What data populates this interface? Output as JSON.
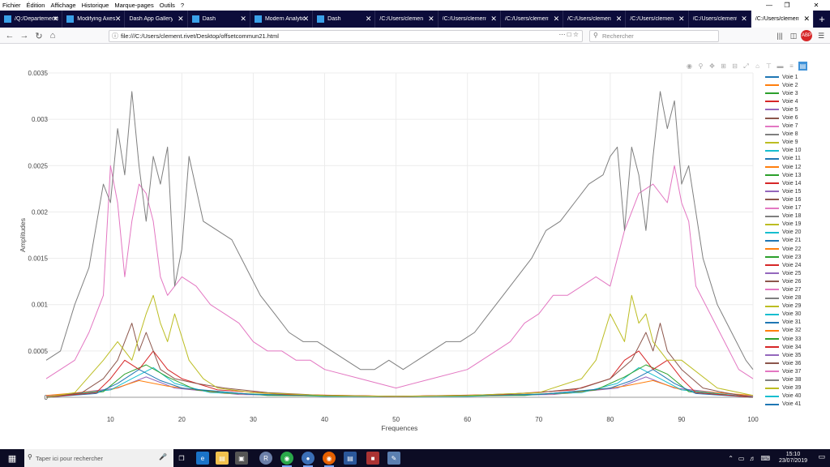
{
  "menubar": {
    "items": [
      "Fichier",
      "Édition",
      "Affichage",
      "Historique",
      "Marque-pages",
      "Outils",
      "?"
    ]
  },
  "tabs": [
    {
      "label": "/Q:/Departements/",
      "icon": "document-icon",
      "active": false
    },
    {
      "label": "Modifying Axes",
      "icon": "plotly-icon",
      "active": false
    },
    {
      "label": "Dash App Gallery",
      "icon": "none",
      "active": false
    },
    {
      "label": "Dash",
      "icon": "dash-icon",
      "active": false
    },
    {
      "label": "Modern Analytic",
      "icon": "plotly-icon",
      "active": false
    },
    {
      "label": "Dash",
      "icon": "dash-icon",
      "active": false
    },
    {
      "label": "/C:/Users/clement.",
      "icon": "none",
      "active": false
    },
    {
      "label": "/C:/Users/clement.",
      "icon": "none",
      "active": false
    },
    {
      "label": "/C:/Users/clement.",
      "icon": "none",
      "active": false
    },
    {
      "label": "/C:/Users/clement.",
      "icon": "none",
      "active": false
    },
    {
      "label": "/C:/Users/clement.",
      "icon": "none",
      "active": false
    },
    {
      "label": "/C:/Users/clement.",
      "icon": "none",
      "active": false
    },
    {
      "label": "/C:/Users/clement.",
      "icon": "none",
      "active": true
    }
  ],
  "navbar": {
    "url": "file:///C:/Users/clement.rivet/Desktop/offsetcommun21.html",
    "search_placeholder": "Rechercher"
  },
  "chart_data": {
    "type": "line",
    "title": "",
    "xlabel": "Frequences",
    "ylabel": "Amplitudes",
    "xlim": [
      1,
      100
    ],
    "ylim": [
      0,
      0.0035
    ],
    "xticks": [
      10,
      20,
      30,
      40,
      50,
      60,
      70,
      80,
      90,
      100
    ],
    "yticks": [
      0,
      0.0005,
      0.001,
      0.0015,
      0.002,
      0.0025,
      0.003,
      0.0035
    ],
    "ytick_labels": [
      "0",
      "0.0005",
      "0.001",
      "0.0015",
      "0.002",
      "0.0025",
      "0.003",
      "0.0035"
    ],
    "grid": true,
    "legend_position": "right",
    "legend": [
      "Voie 1",
      "Voie 2",
      "Voie 3",
      "Voie 4",
      "Voie 5",
      "Voie 6",
      "Voie 7",
      "Voie 8",
      "Voie 9",
      "Voie 10",
      "Voie 11",
      "Voie 12",
      "Voie 13",
      "Voie 14",
      "Voie 15",
      "Voie 16",
      "Voie 17",
      "Voie 18",
      "Voie 19",
      "Voie 20",
      "Voie 21",
      "Voie 22",
      "Voie 23",
      "Voie 24",
      "Voie 25",
      "Voie 26",
      "Voie 27",
      "Voie 28",
      "Voie 29",
      "Voie 30",
      "Voie 31",
      "Voie 32",
      "Voie 33",
      "Voie 34",
      "Voie 35",
      "Voie 36",
      "Voie 37",
      "Voie 38",
      "Voie 39",
      "Voie 40",
      "Voie 41"
    ],
    "colors": [
      "#1f77b4",
      "#ff7f0e",
      "#2ca02c",
      "#d62728",
      "#9467bd",
      "#8c564b",
      "#e377c2",
      "#7f7f7f",
      "#bcbd22",
      "#17becf"
    ],
    "series": [
      {
        "name": "Voie 18",
        "color": "#7f7f7f",
        "x": [
          1,
          3,
          5,
          7,
          9,
          10,
          11,
          12,
          13,
          14,
          15,
          16,
          17,
          18,
          19,
          20,
          21,
          23,
          25,
          27,
          29,
          31,
          33,
          35,
          37,
          39,
          41,
          43,
          45,
          47,
          49,
          51,
          53,
          55,
          57,
          59,
          61,
          63,
          65,
          67,
          69,
          71,
          73,
          75,
          77,
          79,
          80,
          81,
          82,
          83,
          84,
          85,
          86,
          87,
          88,
          89,
          90,
          91,
          93,
          95,
          97,
          99,
          100
        ],
        "y": [
          0.0004,
          0.0005,
          0.001,
          0.0014,
          0.0023,
          0.0021,
          0.0029,
          0.0024,
          0.0033,
          0.0025,
          0.0019,
          0.0026,
          0.0023,
          0.0027,
          0.0012,
          0.0016,
          0.0026,
          0.0019,
          0.0018,
          0.0017,
          0.0014,
          0.0011,
          0.0009,
          0.0007,
          0.0006,
          0.0006,
          0.0005,
          0.0004,
          0.0003,
          0.0003,
          0.0004,
          0.0003,
          0.0004,
          0.0005,
          0.0006,
          0.0006,
          0.0007,
          0.0009,
          0.0011,
          0.0013,
          0.0015,
          0.0018,
          0.0019,
          0.0021,
          0.0023,
          0.0024,
          0.0026,
          0.0027,
          0.0018,
          0.0027,
          0.0024,
          0.0018,
          0.0026,
          0.0033,
          0.0029,
          0.0032,
          0.0023,
          0.0025,
          0.0015,
          0.001,
          0.0007,
          0.0004,
          0.0003
        ]
      },
      {
        "name": "Voie 7",
        "color": "#e377c2",
        "x": [
          1,
          3,
          5,
          7,
          9,
          10,
          11,
          12,
          13,
          14,
          15,
          16,
          17,
          18,
          19,
          20,
          22,
          24,
          26,
          28,
          30,
          32,
          34,
          36,
          38,
          40,
          45,
          50,
          55,
          60,
          62,
          64,
          66,
          68,
          70,
          72,
          74,
          76,
          78,
          80,
          82,
          84,
          86,
          88,
          89,
          90,
          91,
          92,
          94,
          96,
          98,
          100
        ],
        "y": [
          0.0002,
          0.0003,
          0.0004,
          0.0007,
          0.0011,
          0.0025,
          0.0021,
          0.0013,
          0.0019,
          0.0023,
          0.0022,
          0.0019,
          0.0013,
          0.0011,
          0.0012,
          0.0013,
          0.0012,
          0.001,
          0.0009,
          0.0008,
          0.0006,
          0.0005,
          0.0005,
          0.0004,
          0.0004,
          0.0003,
          0.0002,
          0.0001,
          0.0002,
          0.0003,
          0.0004,
          0.0005,
          0.0006,
          0.0008,
          0.0009,
          0.0011,
          0.0011,
          0.0012,
          0.0013,
          0.0012,
          0.0018,
          0.0022,
          0.0023,
          0.0021,
          0.0025,
          0.0021,
          0.0019,
          0.0012,
          0.0009,
          0.0006,
          0.0003,
          0.0002
        ]
      },
      {
        "name": "Voie 9",
        "color": "#bcbd22",
        "x": [
          1,
          5,
          9,
          11,
          13,
          15,
          16,
          17,
          18,
          19,
          21,
          23,
          25,
          30,
          40,
          50,
          60,
          70,
          76,
          78,
          80,
          82,
          83,
          84,
          85,
          86,
          88,
          90,
          95,
          100
        ],
        "y": [
          0,
          5e-05,
          0.0004,
          0.0006,
          0.0004,
          0.0009,
          0.0011,
          0.0008,
          0.0006,
          0.0009,
          0.0004,
          0.0002,
          0.0001,
          5e-05,
          2e-05,
          1e-05,
          2e-05,
          5e-05,
          0.0002,
          0.0004,
          0.0009,
          0.0006,
          0.0011,
          0.0008,
          0.0009,
          0.0006,
          0.0004,
          0.0004,
          0.0001,
          2e-05
        ]
      },
      {
        "name": "Voie 26",
        "color": "#8c564b",
        "x": [
          1,
          6,
          9,
          11,
          12,
          13,
          14,
          15,
          17,
          19,
          22,
          26,
          32,
          40,
          50,
          60,
          70,
          76,
          80,
          83,
          85,
          86,
          87,
          88,
          90,
          93,
          96,
          100
        ],
        "y": [
          0,
          5e-05,
          0.0002,
          0.0004,
          0.0006,
          0.0008,
          0.0005,
          0.0007,
          0.0003,
          0.0002,
          0.00015,
          0.0001,
          5e-05,
          2e-05,
          1e-05,
          2e-05,
          5e-05,
          0.0001,
          0.0002,
          0.0004,
          0.0007,
          0.0005,
          0.0008,
          0.0005,
          0.0003,
          0.0001,
          5e-05,
          0
        ]
      },
      {
        "name": "Voie 4",
        "color": "#d62728",
        "x": [
          1,
          8,
          10,
          12,
          14,
          16,
          18,
          20,
          25,
          35,
          50,
          65,
          75,
          80,
          82,
          84,
          86,
          88,
          90,
          92,
          100
        ],
        "y": [
          0,
          5e-05,
          0.0002,
          0.0004,
          0.0003,
          0.0005,
          0.0003,
          0.0002,
          8e-05,
          3e-05,
          1e-05,
          3e-05,
          8e-05,
          0.0002,
          0.0004,
          0.0005,
          0.0003,
          0.0004,
          0.0002,
          5e-05,
          0
        ]
      },
      {
        "name": "Voie 1",
        "color": "#1f77b4",
        "x": [
          1,
          8,
          11,
          14,
          17,
          20,
          30,
          50,
          70,
          80,
          83,
          86,
          89,
          92,
          100
        ],
        "y": [
          0,
          4e-05,
          0.00015,
          0.0003,
          0.00018,
          0.0001,
          3e-05,
          1e-05,
          3e-05,
          0.0001,
          0.00018,
          0.0003,
          0.00015,
          4e-05,
          0
        ]
      },
      {
        "name": "Voie 3",
        "color": "#2ca02c",
        "x": [
          1,
          9,
          12,
          15,
          18,
          22,
          32,
          50,
          68,
          78,
          82,
          85,
          88,
          91,
          100
        ],
        "y": [
          0,
          6e-05,
          0.00025,
          0.00035,
          0.00022,
          8e-05,
          2e-05,
          1e-05,
          2e-05,
          8e-05,
          0.00022,
          0.00035,
          0.00025,
          6e-05,
          0
        ]
      },
      {
        "name": "Voie 10",
        "color": "#17becf",
        "x": [
          1,
          10,
          13,
          16,
          19,
          24,
          40,
          60,
          76,
          81,
          84,
          87,
          90,
          100
        ],
        "y": [
          0,
          8e-05,
          0.0002,
          0.00032,
          0.00015,
          5e-05,
          1e-05,
          1e-05,
          5e-05,
          0.00015,
          0.00032,
          0.0002,
          8e-05,
          0
        ]
      },
      {
        "name": "Voie 2",
        "color": "#ff7f0e",
        "x": [
          1,
          10,
          14,
          18,
          26,
          50,
          74,
          82,
          86,
          90,
          100
        ],
        "y": [
          2e-05,
          8e-05,
          0.00018,
          0.00012,
          4e-05,
          1e-05,
          4e-05,
          0.00012,
          0.00018,
          8e-05,
          2e-05
        ]
      },
      {
        "name": "Voie 5",
        "color": "#9467bd",
        "x": [
          1,
          11,
          15,
          19,
          28,
          50,
          72,
          81,
          85,
          89,
          100
        ],
        "y": [
          1e-05,
          0.0001,
          0.00022,
          0.0001,
          3e-05,
          1e-05,
          3e-05,
          0.0001,
          0.00022,
          0.0001,
          1e-05
        ]
      }
    ]
  },
  "taskbar": {
    "search_placeholder": "Taper ici pour rechercher",
    "time": "15:10",
    "date": "23/07/2019"
  }
}
